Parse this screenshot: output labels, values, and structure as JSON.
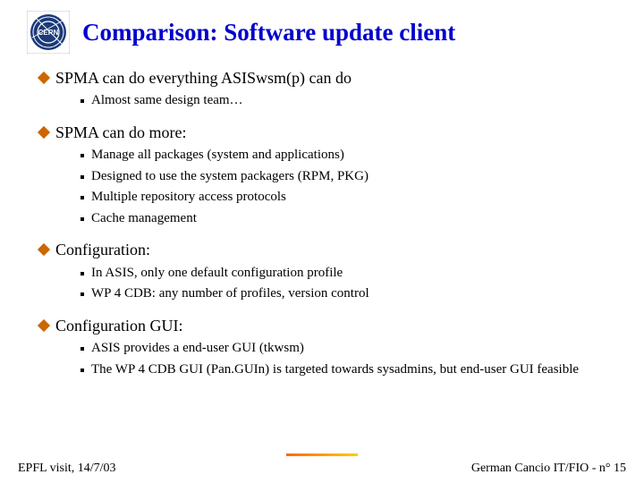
{
  "title": "Comparison: Software update client",
  "bullets": [
    {
      "text": "SPMA can do everything ASISwsm(p) can do",
      "sub": [
        "Almost same design team…"
      ]
    },
    {
      "text": "SPMA can do more:",
      "sub": [
        "Manage all packages (system and applications)",
        "Designed to use the system packagers (RPM, PKG)",
        "Multiple repository access protocols",
        "Cache management"
      ]
    },
    {
      "text": "Configuration:",
      "sub": [
        "In ASIS, only one default configuration profile",
        "WP 4 CDB: any number of profiles, version control"
      ]
    },
    {
      "text": "Configuration GUI:",
      "sub": [
        "ASIS provides a end-user GUI (tkwsm)",
        "The WP 4 CDB GUI (Pan.GUIn) is targeted towards sysadmins, but end-user GUI feasible"
      ]
    }
  ],
  "footer": {
    "left": "EPFL visit, 14/7/03",
    "right": "German Cancio IT/FIO - n° 15"
  }
}
